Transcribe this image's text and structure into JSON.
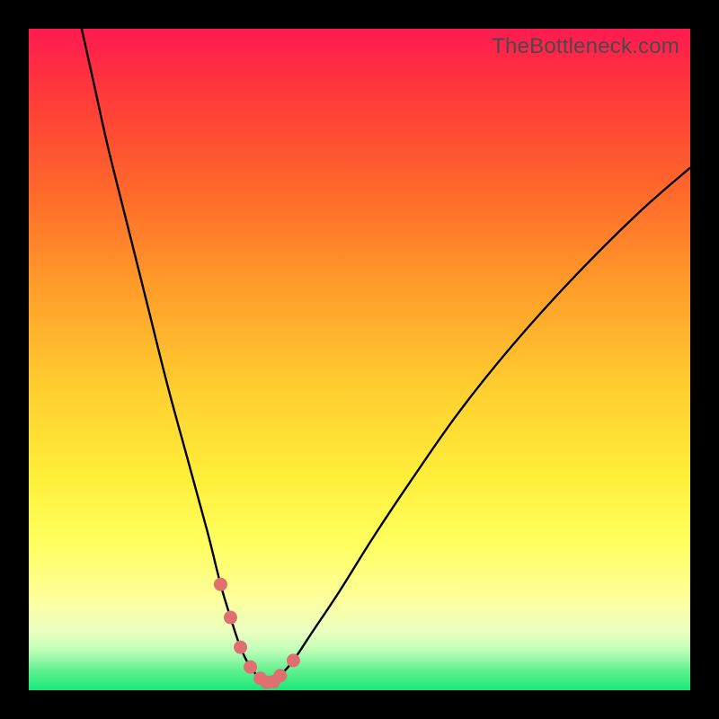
{
  "watermark": "TheBottleneck.com",
  "colors": {
    "background": "#000000",
    "curve": "#000000",
    "markers": "#e07070",
    "gradient_top": "#ff1a50",
    "gradient_bottom": "#18e878"
  },
  "chart_data": {
    "type": "line",
    "title": "",
    "xlabel": "",
    "ylabel": "",
    "xlim": [
      0,
      100
    ],
    "ylim": [
      0,
      100
    ],
    "series": [
      {
        "name": "bottleneck-curve",
        "x": [
          8,
          10,
          12,
          15,
          18,
          21,
          24,
          27,
          29,
          30.5,
          32,
          33.5,
          35,
          36,
          37,
          38,
          40,
          43,
          47,
          52,
          58,
          65,
          73,
          82,
          92,
          100
        ],
        "values": [
          100,
          91,
          82,
          70,
          58,
          46,
          35,
          24,
          16,
          11,
          6.5,
          3.5,
          1.8,
          1.2,
          1.3,
          2.2,
          4.5,
          9,
          15,
          23,
          32,
          42,
          52,
          62,
          72,
          79
        ]
      }
    ],
    "markers": {
      "name": "highlighted-points",
      "x": [
        29,
        30.5,
        32,
        33.5,
        35,
        36,
        37,
        38,
        40
      ],
      "values": [
        16,
        11,
        6.5,
        3.5,
        1.8,
        1.2,
        1.3,
        2.2,
        4.5
      ]
    }
  }
}
